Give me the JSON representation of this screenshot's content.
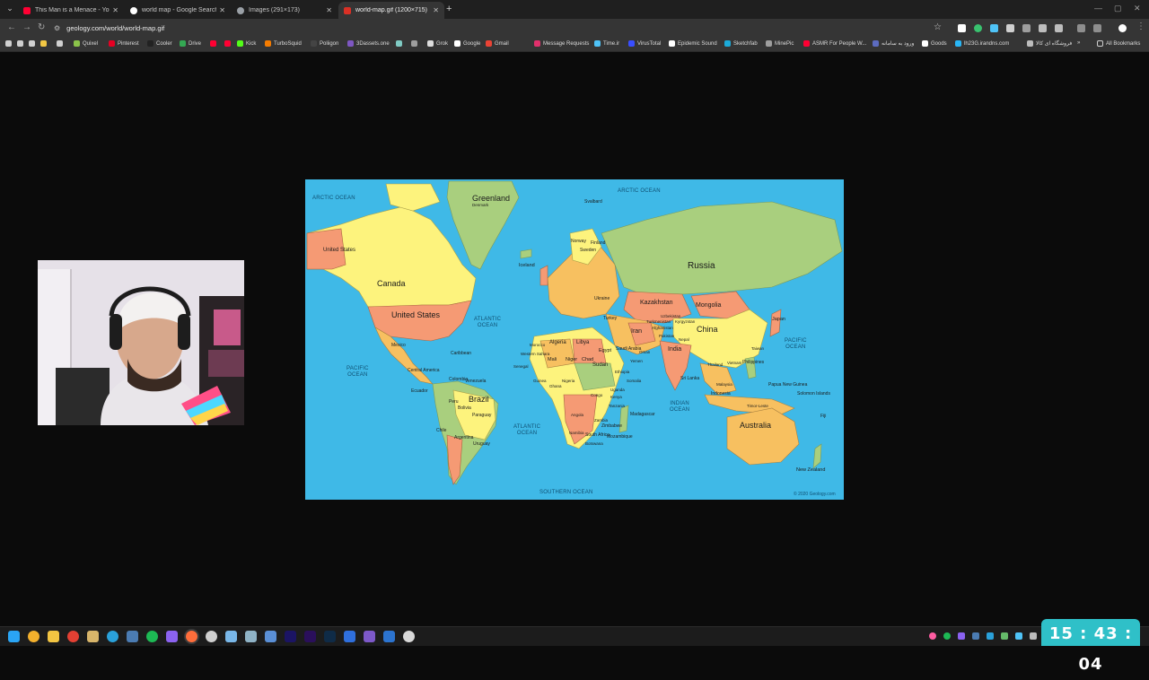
{
  "browser": {
    "tabs": [
      {
        "title": "This Man is a Menace - YouTube",
        "active": false,
        "favicon_color": "#ff0033"
      },
      {
        "title": "world map - Google Search",
        "active": false,
        "favicon_color": "#ffffff"
      },
      {
        "title": "Images (291×173)",
        "active": false,
        "favicon_color": "#9aa0a6"
      },
      {
        "title": "world-map.gif (1200×715)",
        "active": true,
        "favicon_color": "#d93025"
      }
    ],
    "new_tab": "+",
    "url": "geology.com/world/world-map.gif",
    "bookmarks": [
      {
        "label": "",
        "color": "#d0d0d0"
      },
      {
        "label": "",
        "color": "#d0d0d0"
      },
      {
        "label": "",
        "color": "#d0d0d0"
      },
      {
        "label": "",
        "color": "#f2c744"
      },
      {
        "label": "",
        "color": "#d0d0d0"
      },
      {
        "label": "Quixel",
        "color": "#8bc34a"
      },
      {
        "label": "Pinterest",
        "color": "#e60023"
      },
      {
        "label": "Cooler",
        "color": "#222222"
      },
      {
        "label": "Drive",
        "color": "#34a853"
      },
      {
        "label": "",
        "color": "#ff0033"
      },
      {
        "label": "",
        "color": "#ff0033"
      },
      {
        "label": "Kick",
        "color": "#53fc18"
      },
      {
        "label": "TurboSquid",
        "color": "#f57c00"
      },
      {
        "label": "Poliigon",
        "color": "#444444"
      },
      {
        "label": "3Dassets.one",
        "color": "#7e57c2"
      },
      {
        "label": "",
        "color": "#80cbc4"
      },
      {
        "label": "",
        "color": "#9e9e9e"
      },
      {
        "label": "Grok",
        "color": "#dddddd"
      },
      {
        "label": "Google",
        "color": "#ffffff"
      },
      {
        "label": "Gmail",
        "color": "#ea4335"
      },
      {
        "label": "Message Requests",
        "color": "#e1306c"
      },
      {
        "label": "Time.ir",
        "color": "#4fc3f7"
      },
      {
        "label": "VirusTotal",
        "color": "#394eff"
      },
      {
        "label": "Epidemic Sound",
        "color": "#ffffff"
      },
      {
        "label": "Sketchfab",
        "color": "#1caad9"
      },
      {
        "label": "MinePic",
        "color": "#9e9e9e"
      },
      {
        "label": "ASMR For People W...",
        "color": "#ff0033"
      },
      {
        "label": "ورود به سامانه",
        "color": "#5c6bc0"
      },
      {
        "label": "Goods",
        "color": "#ffffff"
      },
      {
        "label": "lh23G.irandns.com",
        "color": "#29b6f6"
      },
      {
        "label": "فروشگاه ای کالا",
        "color": "#bdbdbd"
      }
    ],
    "all_bookmarks": "All Bookmarks"
  },
  "map": {
    "oceans": [
      {
        "text": "ARCTIC OCEAN"
      },
      {
        "text": "ARCTIC OCEAN"
      },
      {
        "text": "ATLANTIC\nOCEAN"
      },
      {
        "text": "PACIFIC\nOCEAN"
      },
      {
        "text": "PACIFIC\nOCEAN"
      },
      {
        "text": "ATLANTIC\nOCEAN"
      },
      {
        "text": "INDIAN\nOCEAN"
      },
      {
        "text": "SOUTHERN OCEAN"
      }
    ],
    "countries_large": [
      "Greenland",
      "Canada",
      "United States",
      "Russia",
      "Brazil",
      "Australia",
      "China"
    ],
    "countries_small": [
      "United States",
      "Iceland",
      "Kazakhstan",
      "Mongolia",
      "Iran",
      "India",
      "Algeria",
      "Libya",
      "Sudan",
      "Japan",
      "Mali",
      "Niger",
      "Chad",
      "Egypt",
      "Saudi Arabia",
      "Argentina",
      "Chile",
      "Peru",
      "Bolivia",
      "Madagascar",
      "Indonesia",
      "Philippines",
      "New Zealand",
      "Papua New Guinea",
      "Caribbean",
      "Mexico",
      "Central America",
      "Ecuador",
      "Venezuela",
      "Colombia",
      "Uruguay",
      "Paraguay",
      "Solomon Islands",
      "Fiji",
      "Sri Lanka",
      "South Africa",
      "Mozambique",
      "Zimbabwe",
      "Norway",
      "Finland",
      "Sweden",
      "Svalbard",
      "Denmark",
      "Afghanistan",
      "Pakistan",
      "Nepal",
      "Turkey",
      "Ukraine",
      "Thailand",
      "Vietnam",
      "Malaysia",
      "Taiwan",
      "Timor-Leste",
      "Kenya",
      "Ethiopia",
      "Somalia",
      "Angola",
      "Namibia",
      "Botswana",
      "Tanzania",
      "Zambia",
      "Uganda",
      "Congo",
      "Nigeria",
      "Ghana",
      "Guinea",
      "Senegal",
      "Western Sahara",
      "Morocco",
      "Yemen",
      "Oman",
      "Kyrgyzstan",
      "Uzbekistan",
      "Turkmenistan"
    ],
    "credit": "© 2020 Geology.com"
  },
  "clock": {
    "time": "15 : 43 : 04"
  },
  "colors": {
    "ocean": "#3fb9e7",
    "green": "#a9cf7e",
    "yellow": "#fdf37d",
    "salmon": "#f59a74",
    "orange": "#f7c060",
    "clock_bg": "#2fc0c8"
  }
}
